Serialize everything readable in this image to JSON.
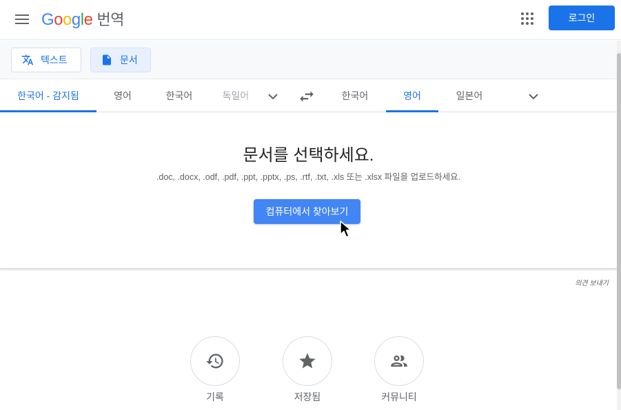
{
  "header": {
    "logo_letters": [
      "G",
      "o",
      "o",
      "g",
      "l",
      "e"
    ],
    "product": "번역",
    "login_label": "로그인"
  },
  "modes": {
    "text_label": "텍스트",
    "document_label": "문서",
    "active": "document"
  },
  "source_langs": [
    {
      "label": "한국어 - 감지됨",
      "active": true
    },
    {
      "label": "영어",
      "active": false
    },
    {
      "label": "한국어",
      "active": false
    },
    {
      "label": "독일어",
      "active": false
    }
  ],
  "target_langs": [
    {
      "label": "한국어",
      "active": false
    },
    {
      "label": "영어",
      "active": true
    },
    {
      "label": "일본어",
      "active": false
    }
  ],
  "document": {
    "title": "문서를 선택하세요.",
    "subtitle": ".doc, .docx, .odf, .pdf, .ppt, .pptx, .ps, .rtf, .txt, .xls 또는 .xlsx 파일을 업로드하세요.",
    "browse_label": "컴퓨터에서 찾아보기"
  },
  "feedback_label": "의견 보내기",
  "bottom": {
    "history_label": "기록",
    "saved_label": "저장됨",
    "community_label": "커뮤니티"
  },
  "colors": {
    "accent": "#1a73e8",
    "button": "#4285f4",
    "icon_gray": "#5f6368"
  }
}
